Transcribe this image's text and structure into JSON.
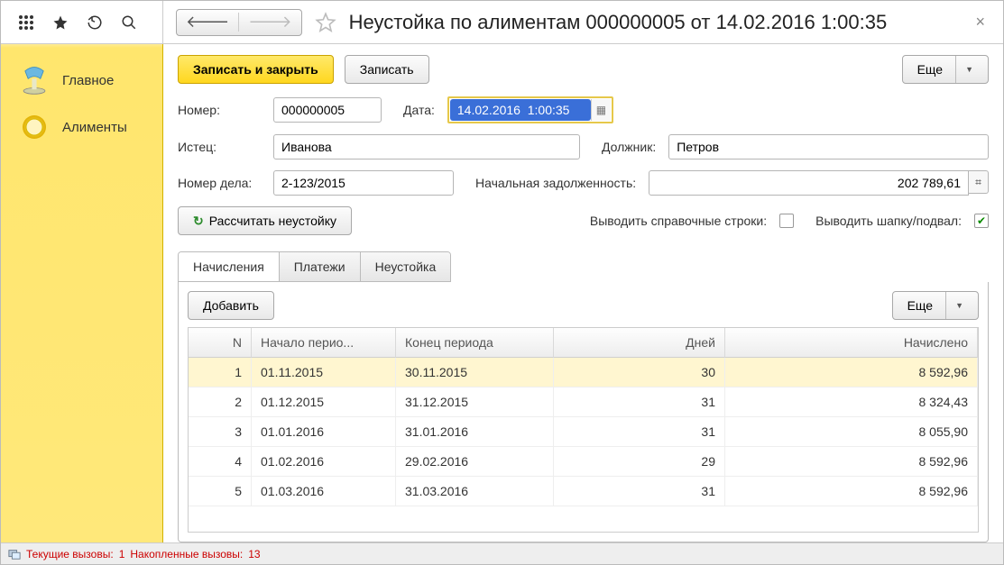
{
  "header": {
    "title": "Неустойка по алиментам 000000005 от 14.02.2016 1:00:35"
  },
  "sidebar": {
    "items": [
      {
        "label": "Главное"
      },
      {
        "label": "Алименты"
      }
    ]
  },
  "actions": {
    "save_close": "Записать и закрыть",
    "save": "Записать",
    "more": "Еще"
  },
  "form": {
    "number_label": "Номер:",
    "number": "000000005",
    "date_label": "Дата:",
    "date": "14.02.2016  1:00:35",
    "plaintiff_label": "Истец:",
    "plaintiff": "Иванова",
    "debtor_label": "Должник:",
    "debtor": "Петров",
    "case_label": "Номер дела:",
    "case": "2-123/2015",
    "initial_debt_label": "Начальная задолженность:",
    "initial_debt": "202 789,61",
    "calc_btn": "Рассчитать неустойку",
    "ref_lines_label": "Выводить справочные строки:",
    "header_footer_label": "Выводить шапку/подвал:"
  },
  "tabs": {
    "t1": "Начисления",
    "t2": "Платежи",
    "t3": "Неустойка",
    "add": "Добавить",
    "more": "Еще",
    "columns": {
      "n": "N",
      "start": "Начало перио...",
      "end": "Конец периода",
      "days": "Дней",
      "amount": "Начислено"
    },
    "rows": [
      {
        "n": "1",
        "start": "01.11.2015",
        "end": "30.11.2015",
        "days": "30",
        "amount": "8 592,96"
      },
      {
        "n": "2",
        "start": "01.12.2015",
        "end": "31.12.2015",
        "days": "31",
        "amount": "8 324,43"
      },
      {
        "n": "3",
        "start": "01.01.2016",
        "end": "31.01.2016",
        "days": "31",
        "amount": "8 055,90"
      },
      {
        "n": "4",
        "start": "01.02.2016",
        "end": "29.02.2016",
        "days": "29",
        "amount": "8 592,96"
      },
      {
        "n": "5",
        "start": "01.03.2016",
        "end": "31.03.2016",
        "days": "31",
        "amount": "8 592,96"
      }
    ]
  },
  "status": {
    "current_label": "Текущие вызовы:",
    "current": "1",
    "accum_label": "Накопленные вызовы:",
    "accum": "13"
  }
}
